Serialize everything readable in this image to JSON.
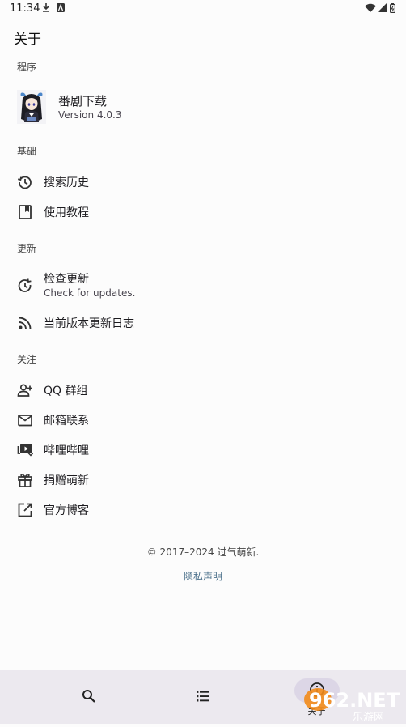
{
  "status_bar": {
    "time": "11:34"
  },
  "page": {
    "title": "关于"
  },
  "sections": {
    "program": "程序",
    "basic": "基础",
    "update": "更新",
    "follow": "关注"
  },
  "app": {
    "name": "番剧下载",
    "version": "Version 4.0.3"
  },
  "basic_items": [
    {
      "label": "搜索历史",
      "icon": "history-icon"
    },
    {
      "label": "使用教程",
      "icon": "bookmark-icon"
    }
  ],
  "update_items": {
    "check": {
      "label": "检查更新",
      "sub": "Check for updates.",
      "icon": "update-icon"
    },
    "changelog": {
      "label": "当前版本更新日志",
      "icon": "rss-icon"
    }
  },
  "follow_items": [
    {
      "label": "QQ 群组",
      "icon": "person-add-icon"
    },
    {
      "label": "邮箱联系",
      "icon": "mail-icon"
    },
    {
      "label": "哔哩哔哩",
      "icon": "video-icon"
    },
    {
      "label": "捐赠萌新",
      "icon": "gift-icon"
    },
    {
      "label": "官方博客",
      "icon": "open-external-icon"
    }
  ],
  "footer": {
    "copyright": "© 2017–2024 过气萌新.",
    "privacy": "隐私声明"
  },
  "bottom_nav": {
    "active_label": "关于"
  },
  "watermark": {
    "text": "962.NET",
    "sub": "乐游网"
  },
  "colors": {
    "background": "#fcfcfc",
    "nav_background": "#ece9ef",
    "link": "#4a6f8a"
  }
}
